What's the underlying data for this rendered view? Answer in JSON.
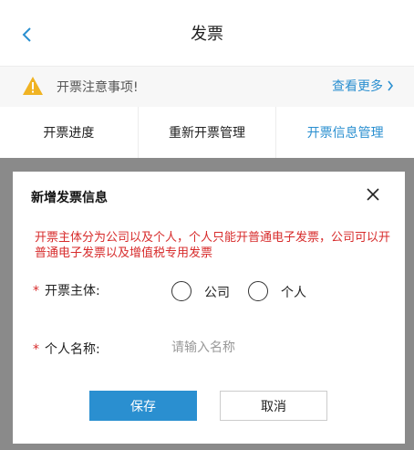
{
  "header": {
    "title": "发票"
  },
  "notice": {
    "text": "开票注意事项!",
    "more_label": "查看更多"
  },
  "tabs": [
    {
      "label": "开票进度"
    },
    {
      "label": "重新开票管理"
    },
    {
      "label": "开票信息管理"
    }
  ],
  "modal": {
    "title": "新增发票信息",
    "tip": "开票主体分为公司以及个人，个人只能开普通电子发票，公司可以开普通电子发票以及增值税专用发票",
    "subject": {
      "required_mark": "*",
      "label": "开票主体:",
      "options": [
        {
          "label": "公司"
        },
        {
          "label": "个人"
        }
      ]
    },
    "name": {
      "required_mark": "*",
      "label": "个人名称:",
      "value": "",
      "placeholder": "请输入名称"
    },
    "save_label": "保存",
    "cancel_label": "取消"
  },
  "colors": {
    "accent": "#2a8fd0",
    "warning": "#f0b323",
    "error_text": "#d72b2b",
    "overlay": "#8a8a8a"
  },
  "icons": [
    "back-icon",
    "warning-icon",
    "chevron-right-icon",
    "close-icon"
  ]
}
